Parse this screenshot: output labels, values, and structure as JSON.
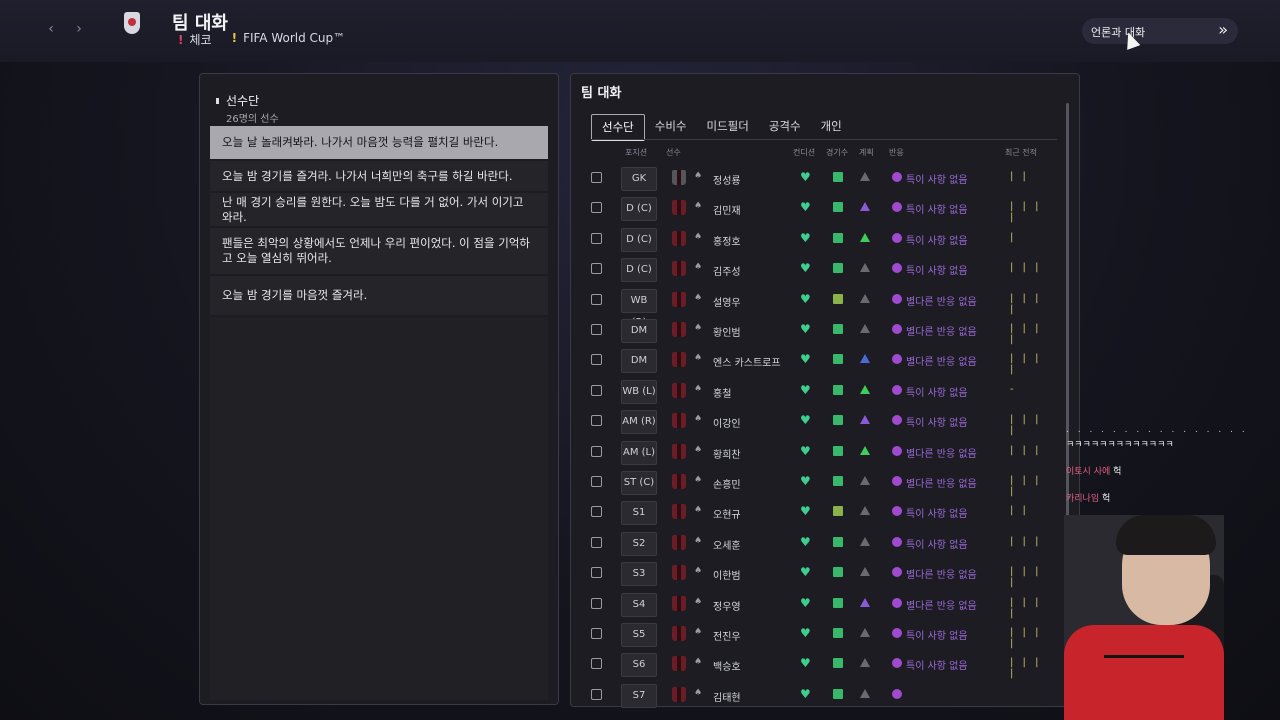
{
  "header": {
    "title": "팀 대화",
    "team": "체코",
    "tournament": "FIFA World Cup™",
    "talk_button": "언론과 대화"
  },
  "left_panel": {
    "heading": "선수단",
    "count": "26명의 선수",
    "options": [
      "오늘 날 놀래켜봐라. 나가서 마음껏 능력을 펼치길 바란다.",
      "오늘 밤 경기를 즐겨라. 나가서 너희만의 축구를 하길 바란다.",
      "난 매 경기 승리를 원한다. 오늘 밤도 다를 거 없어. 가서 이기고 와라.",
      "팬들은 최악의 상황에서도 언제나 우리 편이었다. 이 점을 기억하고 오늘 열심히 뛰어라.",
      "오늘 밤 경기를 마음껏 즐겨라."
    ]
  },
  "right_panel": {
    "title": "팀 대화",
    "tabs": [
      "선수단",
      "수비수",
      "미드필더",
      "공격수",
      "개인"
    ],
    "columns": [
      "포지션",
      "선수",
      "컨디션",
      "경기수",
      "계획",
      "반응",
      "최근 전적"
    ],
    "players": [
      {
        "pos": "GK",
        "name": "정성룡",
        "react": "특이 사항 없음",
        "form": "| |"
      },
      {
        "pos": "D (C)",
        "name": "김민재",
        "react": "특이 사항 없음",
        "form": "| | | |"
      },
      {
        "pos": "D (C)",
        "name": "홍정호",
        "react": "특이 사항 없음",
        "form": "|"
      },
      {
        "pos": "D (C)",
        "name": "김주성",
        "react": "특이 사항 없음",
        "form": "| | |"
      },
      {
        "pos": "WB (R)",
        "name": "설영우",
        "react": "별다른 반응 없음",
        "form": "| | | |"
      },
      {
        "pos": "DM",
        "name": "황인범",
        "react": "별다른 반응 없음",
        "form": "| | | |"
      },
      {
        "pos": "DM",
        "name": "엔스 카스트로프",
        "react": "별다른 반응 없음",
        "form": "| | | |"
      },
      {
        "pos": "WB (L)",
        "name": "홍철",
        "react": "특이 사항 없음",
        "form": "-"
      },
      {
        "pos": "AM (R)",
        "name": "이강인",
        "react": "특이 사항 없음",
        "form": "| | | |"
      },
      {
        "pos": "AM (L)",
        "name": "황희찬",
        "react": "별다른 반응 없음",
        "form": "| | |"
      },
      {
        "pos": "ST (C)",
        "name": "손흥민",
        "react": "별다른 반응 없음",
        "form": "| | | |"
      },
      {
        "pos": "S1",
        "name": "오현규",
        "react": "특이 사항 없음",
        "form": "| |"
      },
      {
        "pos": "S2",
        "name": "오세훈",
        "react": "특이 사항 없음",
        "form": "| | |"
      },
      {
        "pos": "S3",
        "name": "이한범",
        "react": "별다른 반응 없음",
        "form": "| | | |"
      },
      {
        "pos": "S4",
        "name": "정우영",
        "react": "별다른 반응 없음",
        "form": "| | | |"
      },
      {
        "pos": "S5",
        "name": "전진우",
        "react": "특이 사항 없음",
        "form": "| | | |"
      },
      {
        "pos": "S6",
        "name": "백승호",
        "react": "특이 사항 없음",
        "form": "| | | |"
      },
      {
        "pos": "S7",
        "name": "김태현",
        "react": "",
        "form": ""
      }
    ]
  },
  "chat": {
    "dots": ". . . . . . . . . . . . . . . .",
    "line1": "ㅋㅋㅋㅋㅋㅋㅋㅋㅋㅋㅋㅋㅋ",
    "line2_user": "이토시 사에",
    "line2_msg": "헉",
    "line3_user": "카리나임",
    "line3_msg": "헉"
  },
  "colors": {
    "accent_green": "#3ecf8e",
    "purple": "#a04ad0",
    "selected_option": "#a8a8ae"
  }
}
